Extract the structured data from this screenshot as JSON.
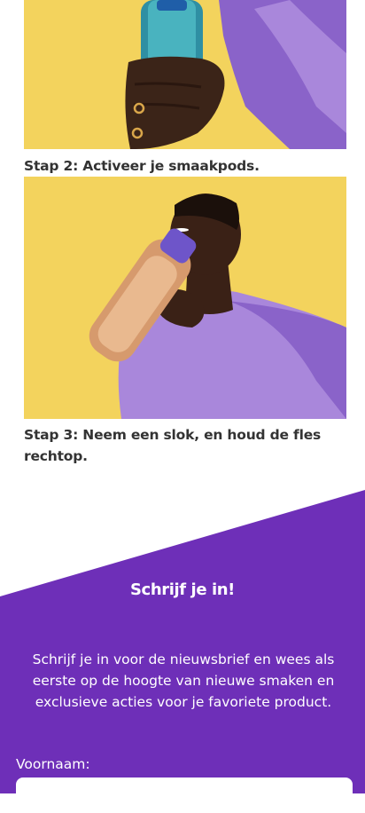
{
  "steps": [
    {
      "label": "Stap 2: Activeer je smaakpods."
    },
    {
      "label": "Stap 3: Neem een slok, en houd de fles rechtop."
    }
  ],
  "signup": {
    "title": "Schrijf je in!",
    "description": "Schrijf je in voor de nieuwsbrief en wees als eerste op de hoogte van nieuwe smaken en exclusieve acties voor je favoriete product.",
    "first_name_label": "Voornaam:",
    "first_name_value": ""
  },
  "colors": {
    "accent": "#6e2fb8",
    "photo_background": "#f3d35d",
    "text_dark": "#333333"
  }
}
